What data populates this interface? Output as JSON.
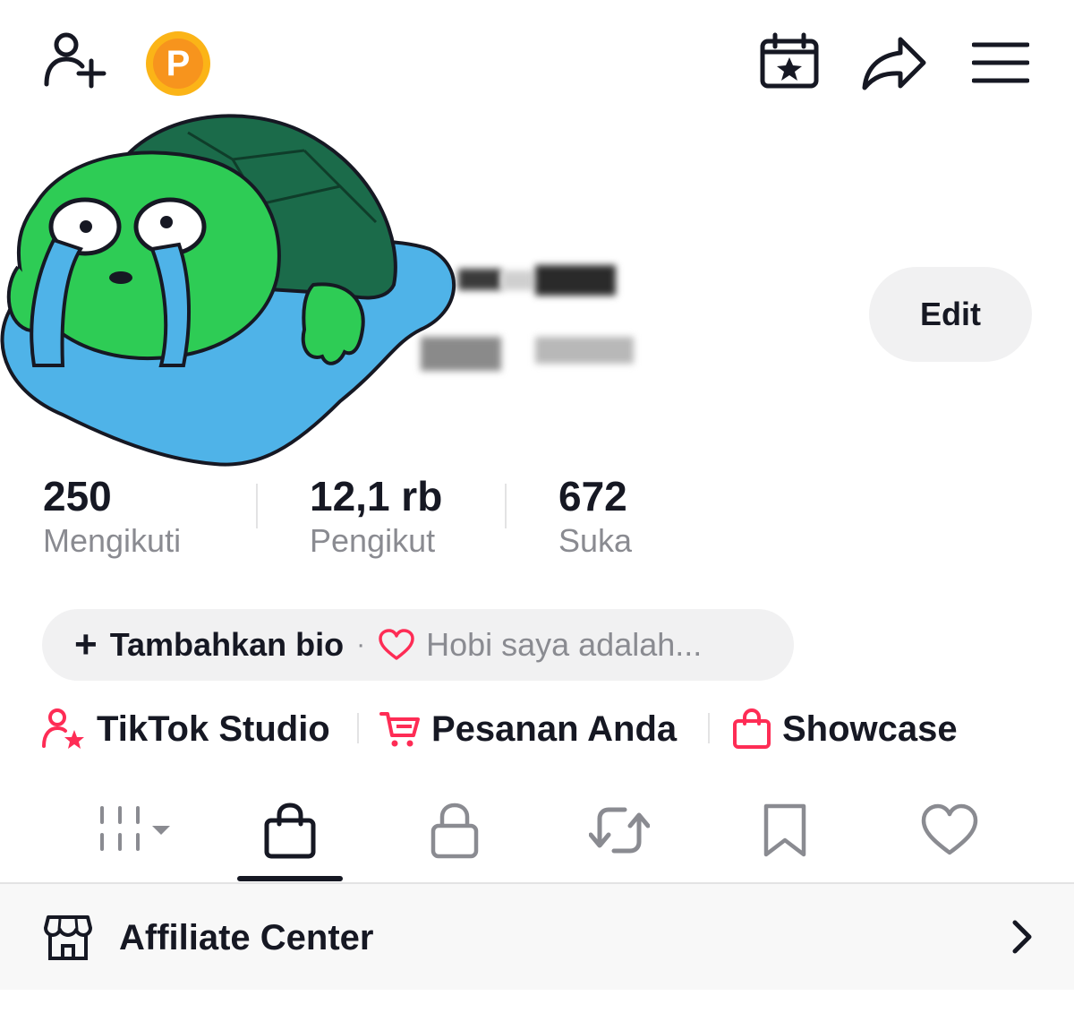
{
  "header": {
    "add_friend_icon": "person-add-icon",
    "coin_label": "P",
    "calendar_icon": "calendar-star-icon",
    "share_icon": "share-arrow-icon",
    "menu_icon": "hamburger-menu-icon"
  },
  "profile": {
    "avatar": "crying-turtle-avatar",
    "edit_label": "Edit"
  },
  "stats": [
    {
      "value": "250",
      "label": "Mengikuti"
    },
    {
      "value": "12,1 rb",
      "label": "Pengikut"
    },
    {
      "value": "672",
      "label": "Suka"
    }
  ],
  "bio": {
    "plus": "+",
    "add_label": "Tambahkan bio",
    "dot": "·",
    "hint": "Hobi saya adalah..."
  },
  "quick_links": [
    {
      "label": "TikTok Studio",
      "icon": "person-star-icon"
    },
    {
      "label": "Pesanan Anda",
      "icon": "cart-icon"
    },
    {
      "label": "Showcase",
      "icon": "shopping-bag-icon"
    }
  ],
  "tabs": [
    {
      "icon": "grid-icon",
      "active": false
    },
    {
      "icon": "shopping-bag-icon",
      "active": true
    },
    {
      "icon": "lock-icon",
      "active": false
    },
    {
      "icon": "repost-icon",
      "active": false
    },
    {
      "icon": "bookmark-icon",
      "active": false
    },
    {
      "icon": "heart-icon",
      "active": false
    }
  ],
  "affiliate": {
    "label": "Affiliate Center",
    "icon": "store-icon"
  },
  "colors": {
    "accent": "#fe2c55",
    "coin": "#f7941d",
    "text": "#161823",
    "muted": "#8a8b91",
    "pill_bg": "#f1f1f2"
  }
}
